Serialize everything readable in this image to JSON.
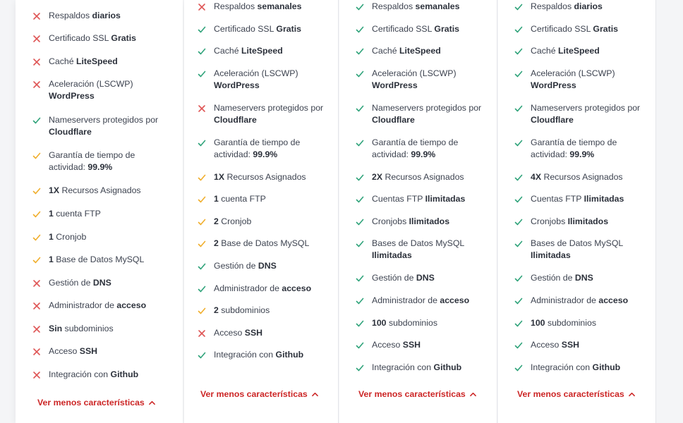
{
  "colors": {
    "check": "#2fa37a",
    "partial": "#f0ae2c",
    "cross": "#df5656",
    "link": "#cc2626"
  },
  "plans": [
    {
      "features": [
        {
          "status": "cross",
          "parts": [
            {
              "t": "Respaldos "
            },
            {
              "t": "diarios",
              "b": true
            }
          ]
        },
        {
          "status": "cross",
          "parts": [
            {
              "t": "Certificado SSL "
            },
            {
              "t": "Gratis",
              "b": true
            }
          ]
        },
        {
          "status": "cross",
          "parts": [
            {
              "t": "Caché "
            },
            {
              "t": "LiteSpeed",
              "b": true
            }
          ]
        },
        {
          "status": "cross",
          "parts": [
            {
              "t": "Aceleración (LSCWP) "
            },
            {
              "t": "WordPress",
              "b": true
            }
          ]
        },
        {
          "status": "check",
          "parts": [
            {
              "t": "Nameservers protegidos por "
            },
            {
              "t": "Cloudflare",
              "b": true
            }
          ]
        },
        {
          "status": "partial",
          "parts": [
            {
              "t": "Garantía de tiempo de actividad: "
            },
            {
              "t": "99.9%",
              "b": true
            }
          ]
        },
        {
          "status": "partial",
          "parts": [
            {
              "t": "1X",
              "b": true
            },
            {
              "t": " Recursos Asignados"
            }
          ]
        },
        {
          "status": "partial",
          "parts": [
            {
              "t": "1",
              "b": true
            },
            {
              "t": " cuenta FTP"
            }
          ]
        },
        {
          "status": "partial",
          "parts": [
            {
              "t": "1",
              "b": true
            },
            {
              "t": " Cronjob"
            }
          ]
        },
        {
          "status": "partial",
          "parts": [
            {
              "t": "1",
              "b": true
            },
            {
              "t": " Base de Datos MySQL"
            }
          ]
        },
        {
          "status": "cross",
          "parts": [
            {
              "t": "Gestión de "
            },
            {
              "t": "DNS",
              "b": true
            }
          ]
        },
        {
          "status": "cross",
          "parts": [
            {
              "t": "Administrador de "
            },
            {
              "t": "acceso",
              "b": true
            }
          ]
        },
        {
          "status": "cross",
          "parts": [
            {
              "t": "Sin",
              "b": true
            },
            {
              "t": " subdominios"
            }
          ]
        },
        {
          "status": "cross",
          "parts": [
            {
              "t": "Acceso "
            },
            {
              "t": "SSH",
              "b": true
            }
          ]
        },
        {
          "status": "cross",
          "parts": [
            {
              "t": "Integración con "
            },
            {
              "t": "Github",
              "b": true
            }
          ]
        }
      ],
      "toggle": "Ver menos características"
    },
    {
      "features": [
        {
          "status": "cross",
          "parts": [
            {
              "t": "Respaldos "
            },
            {
              "t": "semanales",
              "b": true
            }
          ]
        },
        {
          "status": "check",
          "parts": [
            {
              "t": "Certificado SSL "
            },
            {
              "t": "Gratis",
              "b": true
            }
          ]
        },
        {
          "status": "check",
          "parts": [
            {
              "t": "Caché "
            },
            {
              "t": "LiteSpeed",
              "b": true
            }
          ]
        },
        {
          "status": "check",
          "parts": [
            {
              "t": "Aceleración (LSCWP) "
            },
            {
              "t": "WordPress",
              "b": true
            }
          ]
        },
        {
          "status": "cross",
          "parts": [
            {
              "t": "Nameservers protegidos por "
            },
            {
              "t": "Cloudflare",
              "b": true
            }
          ]
        },
        {
          "status": "check",
          "parts": [
            {
              "t": "Garantía de tiempo de actividad: "
            },
            {
              "t": "99.9%",
              "b": true
            }
          ]
        },
        {
          "status": "partial",
          "parts": [
            {
              "t": "1X",
              "b": true
            },
            {
              "t": " Recursos Asignados"
            }
          ]
        },
        {
          "status": "partial",
          "parts": [
            {
              "t": "1",
              "b": true
            },
            {
              "t": " cuenta FTP"
            }
          ]
        },
        {
          "status": "partial",
          "parts": [
            {
              "t": "2",
              "b": true
            },
            {
              "t": " Cronjob"
            }
          ]
        },
        {
          "status": "partial",
          "parts": [
            {
              "t": "2",
              "b": true
            },
            {
              "t": " Base de Datos MySQL"
            }
          ]
        },
        {
          "status": "check",
          "parts": [
            {
              "t": "Gestión de "
            },
            {
              "t": "DNS",
              "b": true
            }
          ]
        },
        {
          "status": "check",
          "parts": [
            {
              "t": "Administrador de "
            },
            {
              "t": "acceso",
              "b": true
            }
          ]
        },
        {
          "status": "partial",
          "parts": [
            {
              "t": "2",
              "b": true
            },
            {
              "t": " subdominios"
            }
          ]
        },
        {
          "status": "cross",
          "parts": [
            {
              "t": "Acceso "
            },
            {
              "t": "SSH",
              "b": true
            }
          ]
        },
        {
          "status": "check",
          "parts": [
            {
              "t": "Integración con "
            },
            {
              "t": "Github",
              "b": true
            }
          ]
        }
      ],
      "toggle": "Ver menos características"
    },
    {
      "features": [
        {
          "status": "check",
          "parts": [
            {
              "t": "Respaldos "
            },
            {
              "t": "semanales",
              "b": true
            }
          ]
        },
        {
          "status": "check",
          "parts": [
            {
              "t": "Certificado SSL "
            },
            {
              "t": "Gratis",
              "b": true
            }
          ]
        },
        {
          "status": "check",
          "parts": [
            {
              "t": "Caché "
            },
            {
              "t": "LiteSpeed",
              "b": true
            }
          ]
        },
        {
          "status": "check",
          "parts": [
            {
              "t": "Aceleración (LSCWP) "
            },
            {
              "t": "WordPress",
              "b": true
            }
          ]
        },
        {
          "status": "check",
          "parts": [
            {
              "t": "Nameservers protegidos por "
            },
            {
              "t": "Cloudflare",
              "b": true
            }
          ]
        },
        {
          "status": "check",
          "parts": [
            {
              "t": "Garantía de tiempo de actividad: "
            },
            {
              "t": "99.9%",
              "b": true
            }
          ]
        },
        {
          "status": "check",
          "parts": [
            {
              "t": "2X",
              "b": true
            },
            {
              "t": " Recursos Asignados"
            }
          ]
        },
        {
          "status": "check",
          "parts": [
            {
              "t": "Cuentas FTP "
            },
            {
              "t": "Ilimitadas",
              "b": true
            }
          ]
        },
        {
          "status": "check",
          "parts": [
            {
              "t": "Cronjobs "
            },
            {
              "t": "Ilimitados",
              "b": true
            }
          ]
        },
        {
          "status": "check",
          "parts": [
            {
              "t": "Bases de Datos MySQL "
            },
            {
              "t": "Ilimitadas",
              "b": true
            }
          ]
        },
        {
          "status": "check",
          "parts": [
            {
              "t": "Gestión de "
            },
            {
              "t": "DNS",
              "b": true
            }
          ]
        },
        {
          "status": "check",
          "parts": [
            {
              "t": "Administrador de "
            },
            {
              "t": "acceso",
              "b": true
            }
          ]
        },
        {
          "status": "check",
          "parts": [
            {
              "t": "100",
              "b": true
            },
            {
              "t": " subdominios"
            }
          ]
        },
        {
          "status": "check",
          "parts": [
            {
              "t": "Acceso "
            },
            {
              "t": "SSH",
              "b": true
            }
          ]
        },
        {
          "status": "check",
          "parts": [
            {
              "t": "Integración con "
            },
            {
              "t": "Github",
              "b": true
            }
          ]
        }
      ],
      "toggle": "Ver menos características"
    },
    {
      "features": [
        {
          "status": "check",
          "parts": [
            {
              "t": "Respaldos "
            },
            {
              "t": "diarios",
              "b": true
            }
          ]
        },
        {
          "status": "check",
          "parts": [
            {
              "t": "Certificado SSL "
            },
            {
              "t": "Gratis",
              "b": true
            }
          ]
        },
        {
          "status": "check",
          "parts": [
            {
              "t": "Caché "
            },
            {
              "t": "LiteSpeed",
              "b": true
            }
          ]
        },
        {
          "status": "check",
          "parts": [
            {
              "t": "Aceleración (LSCWP) "
            },
            {
              "t": "WordPress",
              "b": true
            }
          ]
        },
        {
          "status": "check",
          "parts": [
            {
              "t": "Nameservers protegidos por "
            },
            {
              "t": "Cloudflare",
              "b": true
            }
          ]
        },
        {
          "status": "check",
          "parts": [
            {
              "t": "Garantía de tiempo de actividad: "
            },
            {
              "t": "99.9%",
              "b": true
            }
          ]
        },
        {
          "status": "check",
          "parts": [
            {
              "t": "4X",
              "b": true
            },
            {
              "t": " Recursos Asignados"
            }
          ]
        },
        {
          "status": "check",
          "parts": [
            {
              "t": "Cuentas FTP "
            },
            {
              "t": "Ilimitadas",
              "b": true
            }
          ]
        },
        {
          "status": "check",
          "parts": [
            {
              "t": "Cronjobs "
            },
            {
              "t": "Ilimitados",
              "b": true
            }
          ]
        },
        {
          "status": "check",
          "parts": [
            {
              "t": "Bases de Datos MySQL "
            },
            {
              "t": "Ilimitadas",
              "b": true
            }
          ]
        },
        {
          "status": "check",
          "parts": [
            {
              "t": "Gestión de "
            },
            {
              "t": "DNS",
              "b": true
            }
          ]
        },
        {
          "status": "check",
          "parts": [
            {
              "t": "Administrador de "
            },
            {
              "t": "acceso",
              "b": true
            }
          ]
        },
        {
          "status": "check",
          "parts": [
            {
              "t": "100",
              "b": true
            },
            {
              "t": " subdominios"
            }
          ]
        },
        {
          "status": "check",
          "parts": [
            {
              "t": "Acceso "
            },
            {
              "t": "SSH",
              "b": true
            }
          ]
        },
        {
          "status": "check",
          "parts": [
            {
              "t": "Integración con "
            },
            {
              "t": "Github",
              "b": true
            }
          ]
        }
      ],
      "toggle": "Ver menos características"
    }
  ]
}
